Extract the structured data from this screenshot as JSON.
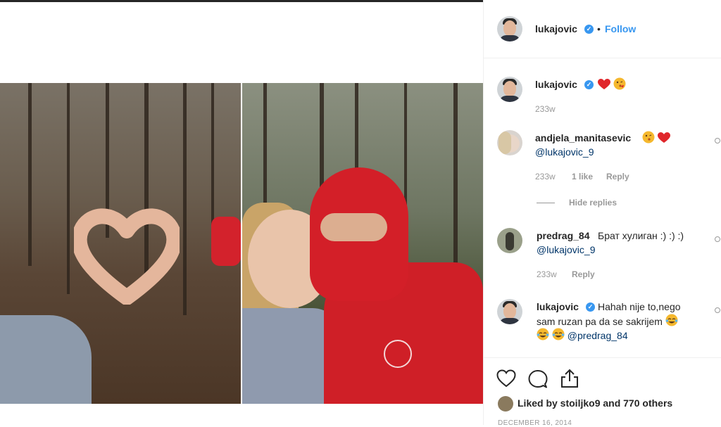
{
  "header": {
    "username": "lukajovic",
    "separator": "•",
    "follow_label": "Follow"
  },
  "comments": [
    {
      "username": "lukajovic",
      "verified": true,
      "text": "",
      "time": "233w",
      "emojis": [
        "red-heart",
        "face-blowing-kiss"
      ]
    },
    {
      "username": "andjela_manitasevic",
      "text": "@lukajovic_9",
      "time": "233w",
      "likes": "1 like",
      "reply_label": "Reply",
      "emojis": [
        "face-blowing-kiss",
        "red-heart"
      ],
      "hide_replies_label": "Hide replies"
    },
    {
      "username": "predrag_84",
      "text": "Брат хулиган :) :) :)",
      "mention": "@lukajovic_9",
      "time": "233w",
      "reply_label": "Reply"
    },
    {
      "username": "lukajovic",
      "verified": true,
      "text_line1": "Hahah nije to,nego",
      "text_line2": "sam ruzan pa da se sakrijem",
      "mention": "@predrag_84",
      "emojis": [
        "tears-of-joy",
        "tears-of-joy",
        "tears-of-joy"
      ]
    }
  ],
  "footer": {
    "likes_text": "Liked by stoiljko9 and 770 others",
    "date": "DECEMBER 16, 2014"
  },
  "colors": {
    "accent": "#3897f0",
    "mention": "#003569",
    "meta": "#999999"
  }
}
